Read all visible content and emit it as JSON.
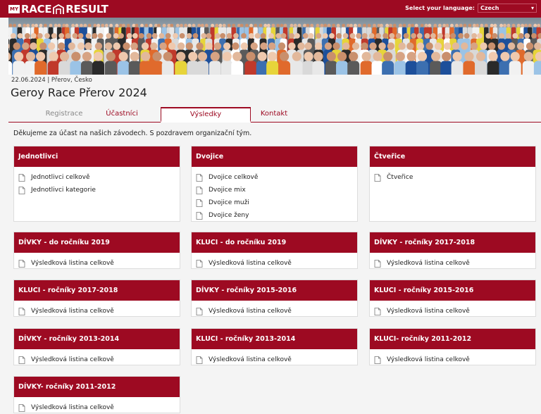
{
  "header": {
    "logo_my": "MY",
    "logo_race": "RACE",
    "logo_result": "RESULT",
    "language_label": "Select your language:",
    "language_value": "Czech"
  },
  "event": {
    "date_location": "22.06.2024 | Přerov, Česko",
    "title": "Geroy Race Přerov 2024"
  },
  "tabs": [
    {
      "label": "Registrace"
    },
    {
      "label": "Účastníci"
    },
    {
      "label": "Výsledky"
    },
    {
      "label": "Kontakt"
    }
  ],
  "intro": "Děkujeme za účast na našich závodech. S pozdravem organizační tým.",
  "cards": [
    {
      "title": "Jednotlivci",
      "items": [
        "Jednotlivci celkově",
        "Jednotlivci kategorie"
      ]
    },
    {
      "title": "Dvojice",
      "items": [
        "Dvojice celkově",
        "Dvojice mix",
        "Dvojice muži",
        "Dvojice ženy"
      ]
    },
    {
      "title": "Čtveřice",
      "items": [
        "Čtveřice"
      ]
    },
    {
      "title": "DÍVKY - do ročníku 2019",
      "items": [
        "Výsledková listina celkově"
      ]
    },
    {
      "title": "KLUCI - do ročníku 2019",
      "items": [
        "Výsledková listina celkově"
      ]
    },
    {
      "title": "DÍVKY - ročníky 2017-2018",
      "items": [
        "Výsledková listina celkově"
      ]
    },
    {
      "title": "KLUCI - ročníky 2017-2018",
      "items": [
        "Výsledková listina celkově"
      ]
    },
    {
      "title": "DÍVKY - ročníky 2015-2016",
      "items": [
        "Výsledková listina celkově"
      ]
    },
    {
      "title": "KLUCI - ročníky 2015-2016",
      "items": [
        "Výsledková listina celkově"
      ]
    },
    {
      "title": "DÍVKY - ročníky 2013-2014",
      "items": [
        "Výsledková listina celkově"
      ]
    },
    {
      "title": "KLUCI - ročníky 2013-2014",
      "items": [
        "Výsledková listina celkově"
      ]
    },
    {
      "title": "KLUCI- ročníky 2011-2012",
      "items": [
        "Výsledková listina celkově"
      ]
    },
    {
      "title": "DÍVKY- ročníky 2011-2012",
      "items": [
        "Výsledková listina celkově"
      ]
    }
  ],
  "colors": {
    "brand": "#9d0a22",
    "background": "#f4f4f4"
  }
}
